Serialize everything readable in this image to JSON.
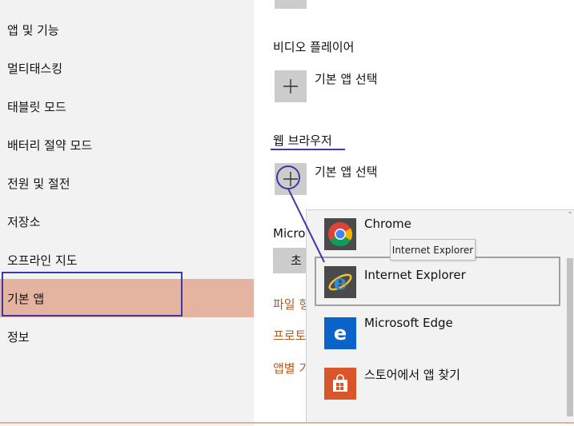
{
  "sidebar": {
    "items": [
      {
        "label": "앱 및 기능"
      },
      {
        "label": "멀티태스킹"
      },
      {
        "label": "태블릿 모드"
      },
      {
        "label": "배터리 절약 모드"
      },
      {
        "label": "전원 및 절전"
      },
      {
        "label": "저장소"
      },
      {
        "label": "오프라인 지도"
      },
      {
        "label": "기본 앱"
      },
      {
        "label": "정보"
      }
    ],
    "active_index": 7
  },
  "main": {
    "video_player": {
      "title": "비디오 플레이어",
      "choose_label": "기본 앱 선택"
    },
    "web_browser": {
      "title": "웹 브라우저",
      "choose_label": "기본 앱 선택"
    },
    "microsoft_partial": "Micro",
    "reset_partial": "초",
    "links": [
      {
        "label": "파일 형"
      },
      {
        "label": "프로토"
      },
      {
        "label": "앱별 기"
      }
    ]
  },
  "flyout": {
    "items": [
      {
        "label": "Chrome",
        "icon": "chrome-icon"
      },
      {
        "label": "Internet Explorer",
        "icon": "internet-explorer-icon"
      },
      {
        "label": "Microsoft Edge",
        "icon": "edge-icon"
      },
      {
        "label": "스토어에서 앱 찾기",
        "icon": "store-icon"
      }
    ],
    "selected_index": 1
  },
  "tooltip": {
    "text": "Internet Explorer"
  },
  "colors": {
    "accent_annotation": "#3a3aa8",
    "active_nav": "#e4b4a0",
    "link": "#b35a1f",
    "edge_blue": "#0a63c9",
    "store_orange": "#d9562b"
  }
}
